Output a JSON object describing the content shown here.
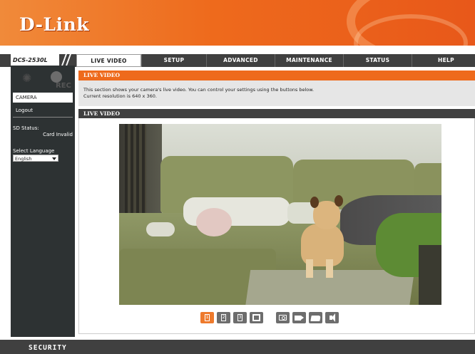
{
  "brand": {
    "logo_text": "D-Link",
    "accent_color": "#ee6a1c",
    "dark_color": "#404040"
  },
  "model": "DCS-2530L",
  "nav": {
    "tabs": [
      {
        "label": "LIVE VIDEO",
        "active": true
      },
      {
        "label": "SETUP",
        "active": false
      },
      {
        "label": "ADVANCED",
        "active": false
      },
      {
        "label": "MAINTENANCE",
        "active": false
      },
      {
        "label": "STATUS",
        "active": false
      },
      {
        "label": "HELP",
        "active": false
      }
    ]
  },
  "sidebar": {
    "rec_label": "REC",
    "items": [
      {
        "label": "CAMERA",
        "active": true
      },
      {
        "label": "Logout",
        "active": false
      }
    ],
    "sd_status_label": "SD Status:",
    "sd_status_value": "Card Invalid",
    "language_label": "Select Language",
    "language_value": "English"
  },
  "main": {
    "section_title": "LIVE VIDEO",
    "description_line1": "This section shows your camera's live video. You can control your settings using the buttons below.",
    "description_line2": "Current resolution is 640 x 360.",
    "video_title": "LIVE VIDEO"
  },
  "toolbar": {
    "profile_buttons": [
      "1",
      "2",
      "3"
    ],
    "active_profile": "1",
    "icons": [
      "fullscreen-icon",
      "snapshot-icon",
      "record-icon",
      "folder-icon",
      "speaker-icon"
    ]
  },
  "footer": {
    "label": "SECURITY"
  }
}
